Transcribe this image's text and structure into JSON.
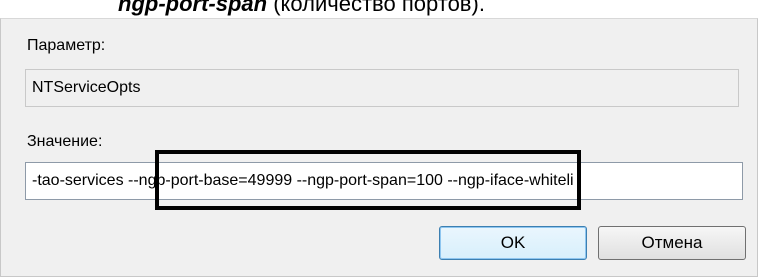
{
  "caption": {
    "code": "ngp-port-span",
    "text": " (количество портов)."
  },
  "dialog": {
    "param_label": "Параметр:",
    "param_value": "NTServiceOpts",
    "value_label": "Значение:",
    "value_text": "-tao-services --ngp-port-base=49999 --ngp-port-span=100 --ngp-iface-whiteli",
    "ok_label": "OK",
    "cancel_label": "Отмена"
  }
}
